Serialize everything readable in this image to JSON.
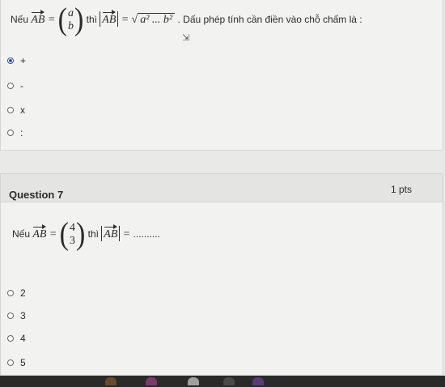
{
  "q6": {
    "stem_prefix": "Nếu",
    "vec": "AB",
    "eq": "=",
    "matrix": [
      "a",
      "b"
    ],
    "then": "thì",
    "eq2": "=",
    "sqrt": "a² ... b²",
    "stem_suffix": ". Dấu phép tính cần điền vào chỗ chấm là :",
    "options": [
      {
        "label": "+",
        "checked": true
      },
      {
        "label": "-",
        "checked": false
      },
      {
        "label": "x",
        "checked": false
      },
      {
        "label": ":",
        "checked": false
      }
    ]
  },
  "q7": {
    "title": "Question 7",
    "points": "1 pts",
    "stem_prefix": "Nếu",
    "vec": "AB",
    "eq": "=",
    "matrix": [
      "4",
      "3"
    ],
    "then": "thì",
    "eq2": "=",
    "blank": "..........",
    "options": [
      {
        "label": "2"
      },
      {
        "label": "3"
      },
      {
        "label": "4"
      },
      {
        "label": "5"
      }
    ]
  },
  "colors": {
    "accent": "#2b50c8",
    "taskbar": "#2a2a2a"
  },
  "icons": [
    "cursor-icon"
  ]
}
